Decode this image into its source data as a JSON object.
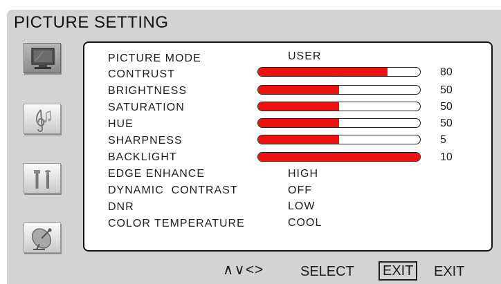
{
  "osd": {
    "title": "PICTURE SETTING",
    "menu_icons": [
      "monitor-icon",
      "music-note-icon",
      "tools-icon",
      "satellite-dish-icon"
    ]
  },
  "rows": [
    {
      "label": "PICTURE MODE",
      "value": "USER"
    },
    {
      "label": "CONTRUST",
      "level": 0.8,
      "number": "80"
    },
    {
      "label": "BRIGHTNESS",
      "level": 0.5,
      "number": "50"
    },
    {
      "label": "SATURATION",
      "level": 0.5,
      "number": "50"
    },
    {
      "label": "HUE",
      "level": 0.5,
      "number": "50"
    },
    {
      "label": "SHARPNESS",
      "level": 0.5,
      "number": "5"
    },
    {
      "label": "BACKLIGHT",
      "level": 1.0,
      "number": "10"
    },
    {
      "label": "EDGE ENHANCE",
      "value": "HIGH"
    },
    {
      "label": "DYNAMIC  CONTRAST",
      "value": "OFF"
    },
    {
      "label": "DNR",
      "value": "LOW"
    },
    {
      "label": "COLOR TEMPERATURE",
      "value": "COOL"
    }
  ],
  "footer": {
    "arrows": "∧∨<>",
    "select_label": "SELECT",
    "exit_key": "EXIT",
    "exit_label": "EXIT"
  },
  "colors": {
    "bar_fill": "#ee1111",
    "osd_background": "#d3d3d3"
  }
}
